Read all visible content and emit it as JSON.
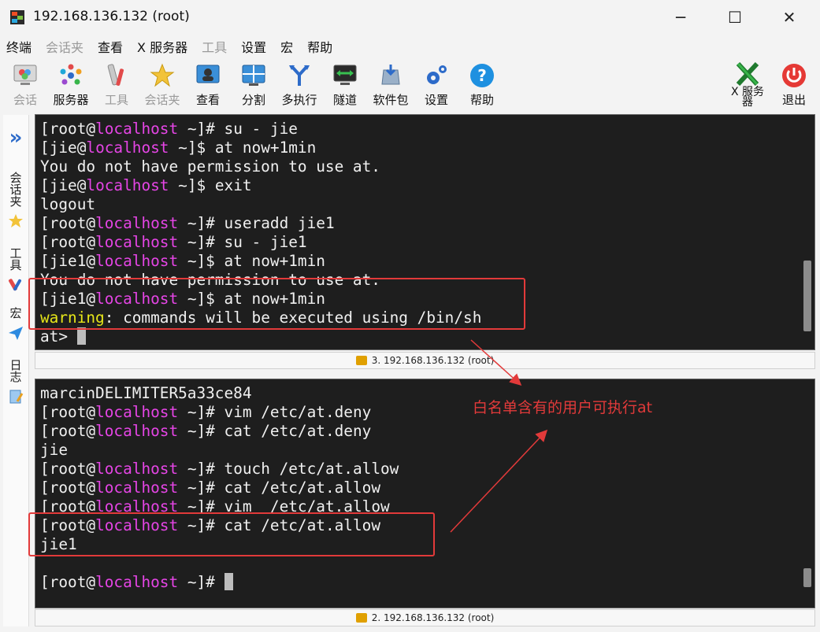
{
  "window": {
    "title": "192.168.136.132 (root)",
    "minimize": "─",
    "maximize": "☐",
    "close": "✕"
  },
  "menu": [
    "终端",
    "会话夹",
    "查看",
    "X 服务器",
    "工具",
    "设置",
    "宏",
    "帮助"
  ],
  "toolbar": {
    "session": "会话",
    "servers": "服务器",
    "tools": "工具",
    "sessions": "会话夹",
    "view": "查看",
    "split": "分割",
    "multiexec": "多执行",
    "tunneling": "隧道",
    "packages": "软件包",
    "settings": "设置",
    "help": "帮助",
    "xserver": "X 服务\n器",
    "exit": "退出"
  },
  "sidebar": {
    "expand": "»",
    "sessions": "会话夹",
    "tools": "工具",
    "macros": "宏",
    "logs": "日志"
  },
  "terminal_top": {
    "status": "3. 192.168.136.132 (root)",
    "lines": [
      {
        "u": "root",
        "h": "localhost",
        "p": " ~]# ",
        "cmd": "su - jie"
      },
      {
        "u": "jie",
        "h": "localhost",
        "p": " ~]$ ",
        "cmd": "at now+1min"
      },
      {
        "text": "You do not have permission to use at."
      },
      {
        "u": "jie",
        "h": "localhost",
        "p": " ~]$ ",
        "cmd": "exit"
      },
      {
        "text": "logout"
      },
      {
        "u": "root",
        "h": "localhost",
        "p": " ~]# ",
        "cmd": "useradd jie1"
      },
      {
        "u": "root",
        "h": "localhost",
        "p": " ~]# ",
        "cmd": "su - jie1"
      },
      {
        "u": "jie1",
        "h": "localhost",
        "p": " ~]$ ",
        "cmd": "at now+1min"
      },
      {
        "text": "You do not have permission to use at."
      },
      {
        "u": "jie1",
        "h": "localhost",
        "p": " ~]$ ",
        "cmd": "at now+1min"
      },
      {
        "warn": "warning",
        "rest": ": commands will be executed using /bin/sh"
      },
      {
        "text": "at> ",
        "cursor": true
      }
    ]
  },
  "terminal_bottom": {
    "status": "2. 192.168.136.132 (root)",
    "lines": [
      {
        "text": "marcinDELIMITER5a33ce84"
      },
      {
        "u": "root",
        "h": "localhost",
        "p": " ~]# ",
        "cmd": "vim /etc/at.deny"
      },
      {
        "u": "root",
        "h": "localhost",
        "p": " ~]# ",
        "cmd": "cat /etc/at.deny"
      },
      {
        "text": "jie"
      },
      {
        "u": "root",
        "h": "localhost",
        "p": " ~]# ",
        "cmd": "touch /etc/at.allow"
      },
      {
        "u": "root",
        "h": "localhost",
        "p": " ~]# ",
        "cmd": "cat /etc/at.allow"
      },
      {
        "u": "root",
        "h": "localhost",
        "p": " ~]# ",
        "cmd": "vim  /etc/at.allow"
      },
      {
        "u": "root",
        "h": "localhost",
        "p": " ~]# ",
        "cmd": "cat /etc/at.allow"
      },
      {
        "text": "jie1"
      },
      {
        "text": ""
      },
      {
        "u": "root",
        "h": "localhost",
        "p": " ~]# ",
        "cmd": "",
        "cursor": true
      }
    ]
  },
  "annotation": "白名单含有的用户可执行at"
}
